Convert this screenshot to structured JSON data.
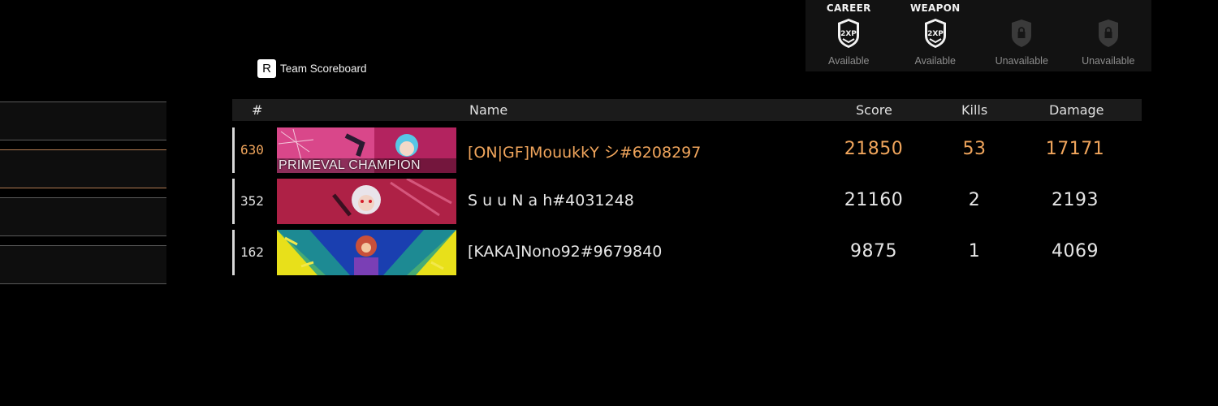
{
  "xp_tokens": [
    {
      "title": "CAREER",
      "icon": "2xp-career-icon",
      "icon_text": "2XP",
      "status": "Available"
    },
    {
      "title": "WEAPON",
      "icon": "2xp-weapon-icon",
      "icon_text": "2XP",
      "status": "Available"
    },
    {
      "title": "",
      "icon": "lock-icon",
      "icon_text": "",
      "status": "Unavailable"
    },
    {
      "title": "",
      "icon": "lock-icon",
      "icon_text": "",
      "status": "Unavailable"
    }
  ],
  "team_scoreboard": {
    "key": "R",
    "label": "Team Scoreboard"
  },
  "columns": {
    "num": "#",
    "name": "Name",
    "score": "Score",
    "kills": "Kills",
    "damage": "Damage"
  },
  "players": [
    {
      "level": "630",
      "card_caption": "PRIMEVAL CHAMPION",
      "name": "[ON|GF]MouukkY シ#6208297",
      "score": "21850",
      "kills": "53",
      "damage": "17171"
    },
    {
      "level": "352",
      "card_caption": "",
      "name": "S u u N a h#4031248",
      "score": "21160",
      "kills": "2",
      "damage": "2193"
    },
    {
      "level": "162",
      "card_caption": "",
      "name": "[KAKA]Nono92#9679840",
      "score": "9875",
      "kills": "1",
      "damage": "4069"
    }
  ],
  "colors": {
    "self_highlight": "#f0a55c",
    "background": "#000000",
    "header_bg": "#1b1b1b"
  }
}
